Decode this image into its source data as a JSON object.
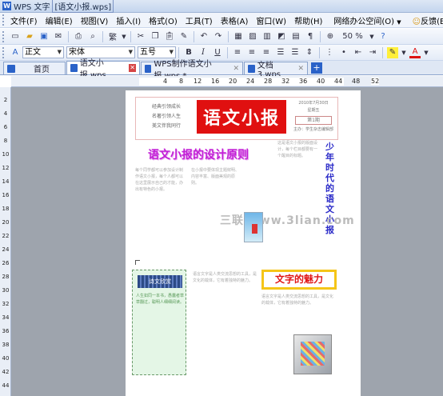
{
  "titlebar": {
    "app": "WPS 文字",
    "document": "[语文小报.wps]"
  },
  "menu": {
    "items": [
      "文件(F)",
      "编辑(E)",
      "视图(V)",
      "插入(I)",
      "格式(O)",
      "工具(T)",
      "表格(A)",
      "窗口(W)",
      "帮助(H)",
      "网络办公空间(O)",
      "反馈(B)"
    ]
  },
  "toolbar1": {
    "chinese_mode": "繁",
    "zoom": "50 %"
  },
  "toolbar2": {
    "style": "正文",
    "font": "宋体",
    "size": "五号",
    "bold": "B",
    "italic": "I",
    "underline": "U"
  },
  "tabs": [
    {
      "label": "首页",
      "active": false
    },
    {
      "label": "语文小报.wps",
      "active": true
    },
    {
      "label": "WPS制作语文小报.wps *",
      "active": false
    },
    {
      "label": "文档 3.wps",
      "active": false
    }
  ],
  "ruler": {
    "numbers": [
      "4",
      "8",
      "12",
      "16",
      "20",
      "24",
      "28",
      "32",
      "36",
      "40",
      "44",
      "48",
      "52"
    ]
  },
  "vruler": {
    "numbers": [
      "2",
      "4",
      "6",
      "8",
      "10",
      "12",
      "14",
      "16",
      "18",
      "20",
      "22",
      "24",
      "26",
      "28",
      "30",
      "32",
      "34",
      "36",
      "38",
      "40",
      "42",
      "44"
    ]
  },
  "page": {
    "header_left": [
      "经典引领成长",
      "名著引领人生",
      "美文伴我同行"
    ],
    "banner": "语文小报",
    "header_right": {
      "line1": "2010年7月30日",
      "line2": "星期五",
      "issue": "第1期",
      "line3": "主办：学生杂志编辑部"
    },
    "big_title": "语文小报的设计原则",
    "vertical_title": "少年时代的语文小报",
    "watermark": "三联 www.3lian.com",
    "green_header": "诗文欣赏",
    "yellow_title": "文字的魅力",
    "body_col1": "每个同学都可以参加设计制作语文小报，每个人都可以在这里展示自己的才能，办出有特色的小报。",
    "body_col2": "在小报中要体现主题鲜明、内容丰富、版面美观的原则。",
    "body_col3": "这是语文小报的版面设计，每个栏目都要有一个醒目的标题。",
    "body_col4": "语言文字是人类交流思想的工具，是文化的载体，它有着独特的魅力。",
    "body_green": "人生如同一本书，愚蠢者草草翻过，聪明人细细阅读。"
  }
}
